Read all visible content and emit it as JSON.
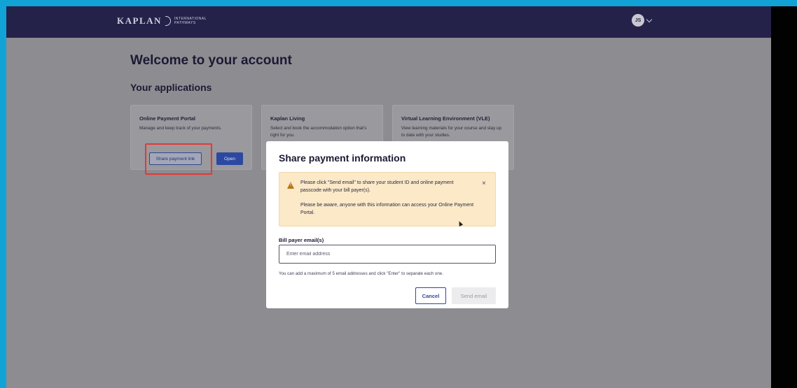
{
  "header": {
    "logo_word": "KAPLAN",
    "logo_sub_line1": "INTERNATIONAL",
    "logo_sub_line2": "PATHWAYS",
    "avatar_initials": "JS"
  },
  "page": {
    "title": "Welcome to your account",
    "section_title": "Your applications"
  },
  "cards": [
    {
      "title": "Online Payment Portal",
      "description": "Manage and keep track of your payments.",
      "share_label": "Share payment link",
      "open_label": "Open"
    },
    {
      "title": "Kaplan Living",
      "description": "Select and book the accommodation option that's right for you."
    },
    {
      "title": "Virtual Learning Environment (VLE)",
      "description": "View learning materials for your course and stay up to date with your studies."
    }
  ],
  "modal": {
    "title": "Share payment information",
    "alert_p1": "Please click \"Send email\" to share your student ID and online payment passcode with your bill payer(s).",
    "alert_p2": "Please be aware, anyone with this information can access your Online Payment Portal.",
    "close_glyph": "×",
    "field_label": "Bill payer email(s)",
    "email_placeholder": "Enter email address",
    "helper_text": "You can add a maximum of 5 email addresses and click \"Enter\" to separate each one.",
    "cancel_label": "Cancel",
    "send_label": "Send email"
  },
  "colors": {
    "header_bg": "#25224a",
    "overlay_bg": "#8d8c91",
    "frame_border": "#12a3d6",
    "primary": "#2c48a0",
    "alert_bg": "#fbe9c8",
    "highlight": "#e23a36"
  },
  "icons": {
    "alert": "warning-icon",
    "dismiss": "close-icon",
    "menu": "chevron-down-icon"
  }
}
